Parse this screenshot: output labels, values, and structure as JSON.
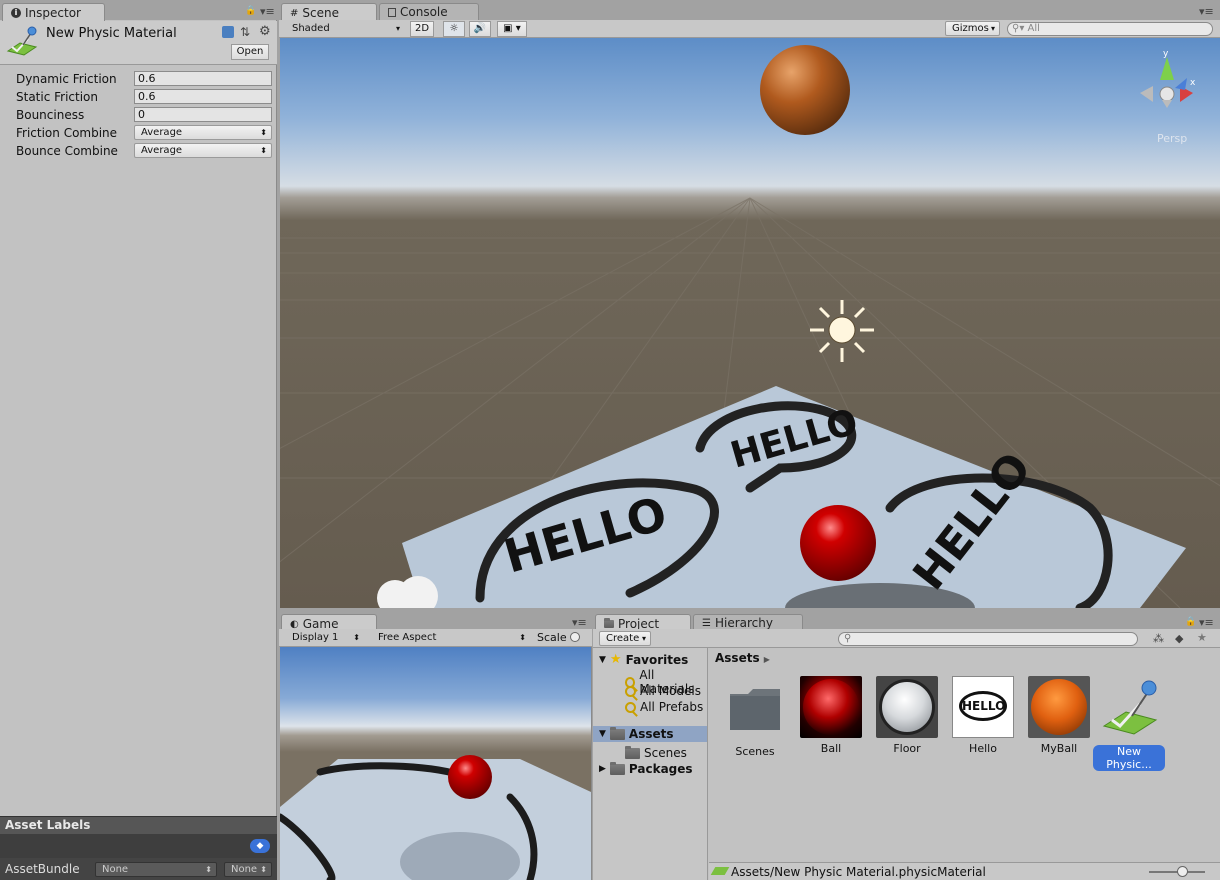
{
  "inspector": {
    "tab": "Inspector",
    "title": "New Physic Material",
    "open_button": "Open",
    "properties": [
      {
        "label": "Dynamic Friction",
        "value": "0.6",
        "kind": "field"
      },
      {
        "label": "Static Friction",
        "value": "0.6",
        "kind": "field"
      },
      {
        "label": "Bounciness",
        "value": "0",
        "kind": "field"
      },
      {
        "label": "Friction Combine",
        "value": "Average",
        "kind": "dropdown"
      },
      {
        "label": "Bounce Combine",
        "value": "Average",
        "kind": "dropdown"
      }
    ],
    "asset_labels": "Asset Labels",
    "asset_bundle": {
      "label": "AssetBundle",
      "value1": "None",
      "value2": "None"
    }
  },
  "scene": {
    "tabs": [
      "Scene",
      "Console"
    ],
    "shading": "Shaded",
    "mode_2d": "2D",
    "gizmos": "Gizmos",
    "search_placeholder": "All",
    "persp": "Persp",
    "gizmo_axis_y": "y",
    "gizmo_axis_x": "x",
    "floor_text": "HELLO"
  },
  "game": {
    "tab": "Game",
    "display": "Display 1",
    "aspect": "Free Aspect",
    "scale": "Scale"
  },
  "project": {
    "tabs": [
      "Project",
      "Hierarchy"
    ],
    "create": "Create",
    "favorites": {
      "label": "Favorites",
      "items": [
        "All Materials",
        "All Models",
        "All Prefabs"
      ]
    },
    "tree": {
      "assets": "Assets",
      "scenes": "Scenes",
      "packages": "Packages"
    },
    "breadcrumb": "Assets",
    "assets": [
      {
        "name": "Scenes"
      },
      {
        "name": "Ball"
      },
      {
        "name": "Floor"
      },
      {
        "name": "Hello",
        "text": "HELLO"
      },
      {
        "name": "MyBall"
      },
      {
        "name": "New Physic..."
      }
    ],
    "footer_path": "Assets/New Physic Material.physicMaterial"
  },
  "colors": {
    "selection": "#3a72d8",
    "panel": "#c2c2c2",
    "accent_green": "#6db33f"
  }
}
